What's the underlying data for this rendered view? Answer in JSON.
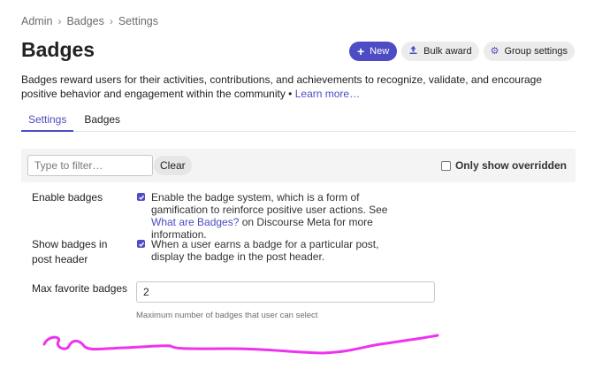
{
  "breadcrumb": [
    "Admin",
    "Badges",
    "Settings"
  ],
  "header": {
    "title": "Badges",
    "actions": {
      "new_label": "New",
      "bulk_award_label": "Bulk award",
      "group_settings_label": "Group settings"
    }
  },
  "description": {
    "text": "Badges reward users for their activities, contributions, and achievements to recognize, validate, and encourage positive behavior and engagement within the community • ",
    "link": "Learn more…"
  },
  "tabs": [
    {
      "label": "Settings",
      "active": true
    },
    {
      "label": "Badges",
      "active": false
    }
  ],
  "filter": {
    "placeholder": "Type to filter…",
    "clear_label": "Clear",
    "only_overridden_label": "Only show overridden",
    "only_overridden_checked": false
  },
  "settings": {
    "enable_badges": {
      "label": "Enable badges",
      "checked": true,
      "desc_before": "Enable the badge system, which is a form of gamification to reinforce positive user actions. See ",
      "link": "What are Badges?",
      "desc_after": " on Discourse Meta for more information."
    },
    "show_badges_in_post_header": {
      "label": "Show badges in post header",
      "checked": true,
      "desc": "When a user earns a badge for a particular post, display the badge in the post header."
    },
    "max_favorite_badges": {
      "label": "Max favorite badges",
      "value": "2",
      "help": "Maximum number of badges that user can select"
    }
  },
  "colors": {
    "accent": "#4e4cc5",
    "annotation": "#ee33ee"
  },
  "icons": {
    "breadcrumb_separator": "chevron-right-icon",
    "new": "plus-icon",
    "bulk_award": "upload-icon",
    "group_settings": "gear-icon"
  }
}
